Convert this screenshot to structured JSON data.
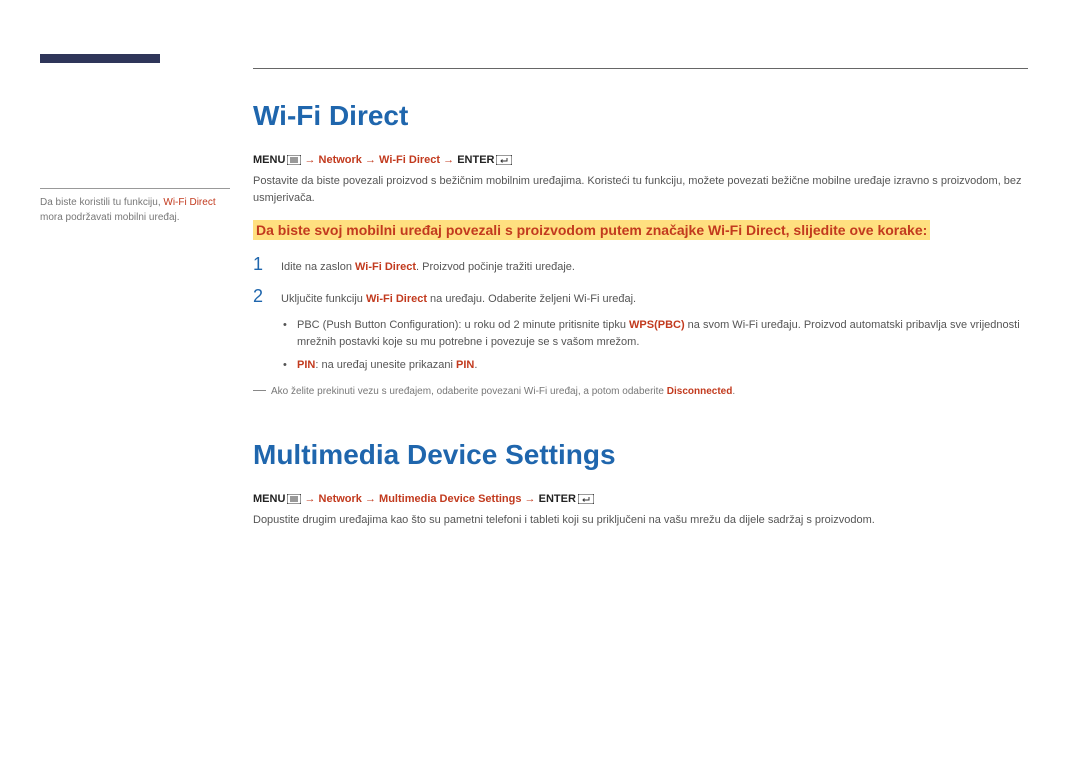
{
  "sidebar": {
    "note_pre": "Da biste koristili tu funkciju, ",
    "note_hl": "Wi-Fi Direct",
    "note_post": " mora podržavati mobilni uređaj."
  },
  "s1": {
    "title": "Wi-Fi Direct",
    "nav_menu": "MENU",
    "nav_a1": " → ",
    "nav_net": "Network",
    "nav_a2": " → ",
    "nav_wfd": "Wi-Fi Direct",
    "nav_a3": " → ",
    "nav_enter": "ENTER",
    "intro": "Postavite da biste povezali proizvod s bežičnim mobilnim uređajima. Koristeći tu funkciju, možete povezati bežične mobilne uređaje izravno s proizvodom, bez usmjerivača.",
    "highlight": "Da biste svoj mobilni uređaj povezali s proizvodom putem značajke Wi-Fi Direct, slijedite ove korake:",
    "step1_num": "1",
    "step1_a": "Idite na zaslon ",
    "step1_b": "Wi-Fi Direct",
    "step1_c": ". Proizvod počinje tražiti uređaje.",
    "step2_num": "2",
    "step2_a": "Uključite funkciju ",
    "step2_b": "Wi-Fi Direct",
    "step2_c": " na uređaju. Odaberite željeni Wi-Fi uređaj.",
    "b1_a": "PBC (Push Button Configuration): u roku od 2 minute pritisnite tipku ",
    "b1_b": "WPS(PBC)",
    "b1_c": " na svom Wi-Fi uređaju. Proizvod automatski pribavlja sve vrijednosti mrežnih postavki koje su mu potrebne i povezuje se s vašom mrežom.",
    "b2_a": "PIN",
    "b2_b": ": na uređaj unesite prikazani ",
    "b2_c": "PIN",
    "b2_d": ".",
    "dn_a": "Ako želite prekinuti vezu s uređajem, odaberite povezani Wi-Fi uređaj, a potom odaberite ",
    "dn_b": "Disconnected",
    "dn_c": "."
  },
  "s2": {
    "title": "Multimedia Device Settings",
    "nav_menu": "MENU",
    "nav_a1": " → ",
    "nav_net": "Network",
    "nav_a2": " → ",
    "nav_mds": "Multimedia Device Settings",
    "nav_a3": " → ",
    "nav_enter": "ENTER",
    "intro": "Dopustite drugim uređajima kao što su pametni telefoni i tableti koji su priključeni na vašu mrežu da dijele sadržaj s proizvodom."
  }
}
